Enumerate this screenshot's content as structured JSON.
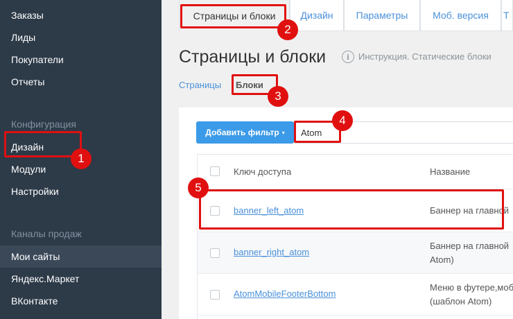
{
  "sidebar": {
    "items_top": [
      "Заказы",
      "Лиды",
      "Покупатели",
      "Отчеты"
    ],
    "group_config": "Конфигурация",
    "items_config": [
      "Дизайн",
      "Модули",
      "Настройки"
    ],
    "group_channels": "Каналы продаж",
    "items_channels": [
      "Мои сайты",
      "Яндекс.Маркет",
      "ВКонтакте"
    ]
  },
  "tabs": [
    "Страницы и блоки",
    "Дизайн",
    "Параметры",
    "Моб. версия",
    "Т"
  ],
  "page": {
    "title": "Страницы и блоки",
    "help_icon": "info-icon",
    "help_glyph": "i",
    "help_link": "Инструкция. Статические блоки"
  },
  "subtabs": [
    "Страницы",
    "Блоки"
  ],
  "filter": {
    "button_label": "Добавить фильтр",
    "caret": "▾",
    "search_value": "Atom"
  },
  "table": {
    "headers": [
      "Ключ доступа",
      "Название"
    ],
    "rows": [
      {
        "key": "banner_left_atom",
        "name_line1": "Баннер на главной",
        "name_line2": ""
      },
      {
        "key": "banner_right_atom",
        "name_line1": "Баннер на главной",
        "name_line2": "Atom)"
      },
      {
        "key": "AtomMobileFooterBottom",
        "name_line1": "Меню в футере,моб",
        "name_line2": "(шаблон Atom)"
      }
    ]
  },
  "annotations": [
    "1",
    "2",
    "3",
    "4",
    "5"
  ],
  "colors": {
    "sidebar_bg": "#2d3a48",
    "accent": "#3c9be8",
    "link": "#4a90d9",
    "annotation": "#e01010"
  }
}
